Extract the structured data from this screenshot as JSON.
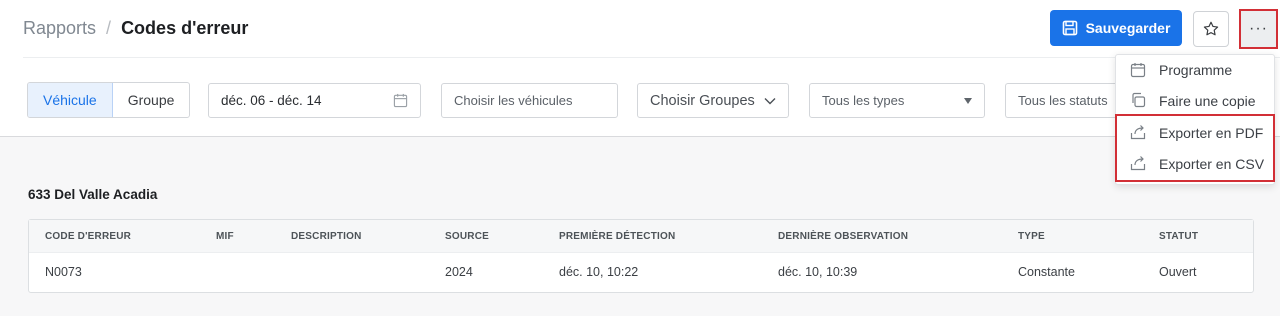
{
  "breadcrumb": {
    "root": "Rapports",
    "separator": "/",
    "current": "Codes d'erreur"
  },
  "header": {
    "save_label": "Sauvegarder",
    "more_label": "···"
  },
  "filters": {
    "segment": [
      "Véhicule",
      "Groupe"
    ],
    "date_range": "déc. 06 - déc. 14",
    "vehicles_placeholder": "Choisir les véhicules",
    "groups_placeholder": "Choisir Groupes",
    "types_value": "Tous les types",
    "status_value": "Tous les statuts"
  },
  "menu": {
    "items": [
      {
        "label": "Programme",
        "icon": "calendar-icon"
      },
      {
        "label": "Faire une copie",
        "icon": "copy-icon"
      },
      {
        "label": "Exporter en PDF",
        "icon": "export-icon"
      },
      {
        "label": "Exporter en CSV",
        "icon": "export-icon"
      }
    ]
  },
  "section": {
    "title": "633 Del Valle Acadia"
  },
  "table": {
    "columns": [
      "CODE D'ERREUR",
      "MIF",
      "DESCRIPTION",
      "SOURCE",
      "PREMIÈRE DÉTECTION",
      "DERNIÈRE OBSERVATION",
      "TYPE",
      "STATUT"
    ],
    "rows": [
      [
        "N0073",
        "",
        "",
        "2024",
        "déc. 10, 10:22",
        "déc. 10, 10:39",
        "Constante",
        "Ouvert"
      ]
    ]
  },
  "colors": {
    "accent": "#1a73e8",
    "highlight": "#d22f36"
  }
}
